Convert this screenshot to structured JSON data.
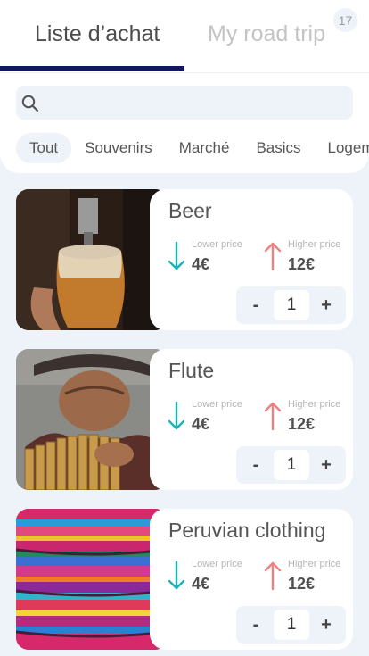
{
  "tabs": [
    {
      "label": "Liste d’achat",
      "active": true
    },
    {
      "label": "My road trip",
      "active": false
    }
  ],
  "badge": "17",
  "search": {
    "value": "",
    "placeholder": ""
  },
  "chips": [
    "Tout",
    "Souvenirs",
    "Marché",
    "Basics",
    "Logement"
  ],
  "products": [
    {
      "name": "Beer",
      "lower_label": "Lower price",
      "lower_value": "4€",
      "higher_label": "Higher price",
      "higher_value": "12€",
      "quantity": "1",
      "minus": "-",
      "plus": "+"
    },
    {
      "name": "Flute",
      "lower_label": "Lower price",
      "lower_value": "4€",
      "higher_label": "Higher price",
      "higher_value": "12€",
      "quantity": "1",
      "minus": "-",
      "plus": "+"
    },
    {
      "name": "Peruvian clothing",
      "lower_label": "Lower price",
      "lower_value": "4€",
      "higher_label": "Higher price",
      "higher_value": "12€",
      "quantity": "1",
      "minus": "-",
      "plus": "+"
    }
  ],
  "colors": {
    "accent": "#0e1a5a",
    "down": "#1bb3b3",
    "up": "#f07f7f",
    "background": "#eef2f9"
  },
  "icons": {
    "search": "search-icon",
    "lower": "arrow-down-icon",
    "higher": "arrow-up-icon"
  }
}
